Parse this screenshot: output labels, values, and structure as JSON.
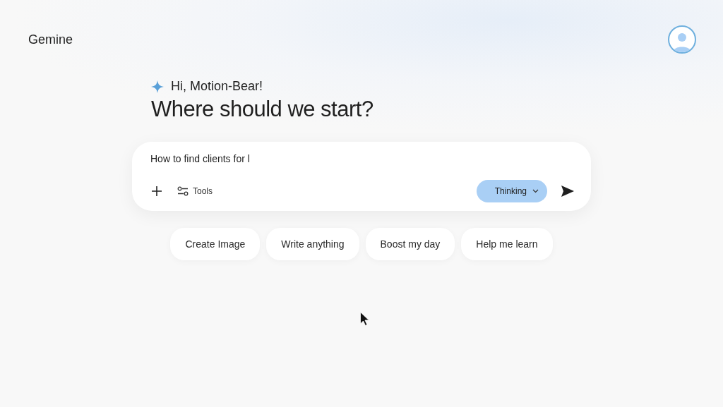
{
  "app": {
    "title": "Gemine"
  },
  "greeting": "Hi, Motion-Bear!",
  "heading": "Where should we start?",
  "prompt": {
    "value": "How to find clients for l",
    "tools_label": "Tools",
    "mode_label": "Thinking"
  },
  "suggestions": [
    "Create Image",
    "Write anything",
    "Boost my day",
    "Help me learn"
  ]
}
